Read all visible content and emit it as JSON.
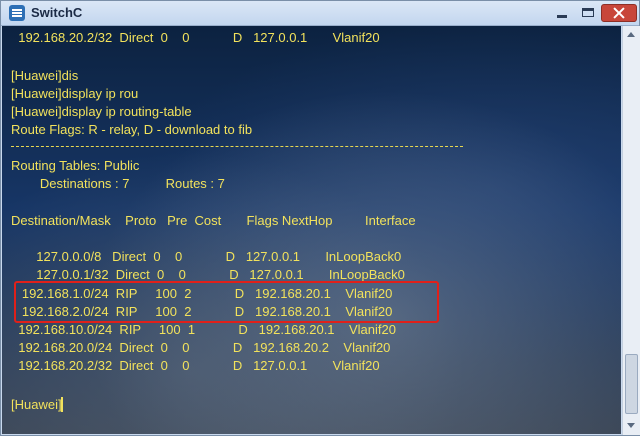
{
  "window": {
    "title": "SwitchC",
    "app_icon": "terminal-app-icon",
    "controls": [
      "minimize-icon",
      "maximize-icon",
      "close-icon"
    ]
  },
  "terminal": {
    "text_color": "#f2e25c",
    "highlight_color": "#e0201a",
    "lines": [
      "  192.168.20.2/32  Direct  0    0            D   127.0.0.1       Vlanif20",
      "",
      "[Huawei]dis",
      "[Huawei]display ip rou",
      "[Huawei]display ip routing-table",
      "Route Flags: R - relay, D - download to fib",
      "",
      "Routing Tables: Public",
      "        Destinations : 7          Routes : 7",
      "",
      "Destination/Mask    Proto   Pre  Cost       Flags NextHop         Interface",
      "",
      "       127.0.0.0/8   Direct  0    0            D   127.0.0.1       InLoopBack0",
      "       127.0.0.1/32  Direct  0    0            D   127.0.0.1       InLoopBack0",
      "   192.168.1.0/24  RIP     100  2            D   192.168.20.1    Vlanif20",
      "   192.168.2.0/24  RIP     100  2            D   192.168.20.1    Vlanif20",
      "  192.168.10.0/24  RIP     100  1            D   192.168.20.1    Vlanif20",
      "  192.168.20.0/24  Direct  0    0            D   192.168.20.2    Vlanif20",
      "  192.168.20.2/32  Direct  0    0            D   127.0.0.1       Vlanif20",
      "",
      "",
      "[Huawei]"
    ]
  }
}
